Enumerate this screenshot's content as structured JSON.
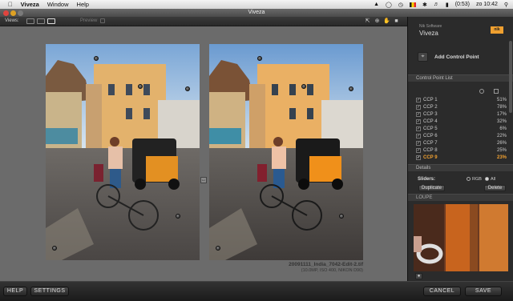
{
  "menubar": {
    "app": "Viveza",
    "items": [
      "Window",
      "Help"
    ],
    "battery": "(0:53)",
    "clock": "zo 10:42"
  },
  "window": {
    "title": "Viveza"
  },
  "toolbar": {
    "views_label": "Views:",
    "preview_label": "Preview"
  },
  "canvas": {
    "filename": "20091111_India_7042-Edit-2.tif",
    "meta": "(10.0MP, ISO 400, NIKON D90)"
  },
  "panel": {
    "brand_small": "Nik Software",
    "brand": "Viveza",
    "brand_badge": "nik",
    "add_control_point": "Add Control Point",
    "cp_list_header": "Control Point List",
    "control_points": [
      {
        "name": "CCP 1",
        "pct": "51%",
        "checked": true,
        "selected": false
      },
      {
        "name": "CCP 2",
        "pct": "78%",
        "checked": true,
        "selected": false
      },
      {
        "name": "CCP 3",
        "pct": "17%",
        "checked": true,
        "selected": false
      },
      {
        "name": "CCP 4",
        "pct": "32%",
        "checked": true,
        "selected": false
      },
      {
        "name": "CCP 5",
        "pct": "6%",
        "checked": true,
        "selected": false
      },
      {
        "name": "CCP 6",
        "pct": "22%",
        "checked": true,
        "selected": false
      },
      {
        "name": "CCP 7",
        "pct": "26%",
        "checked": true,
        "selected": false
      },
      {
        "name": "CCP 8",
        "pct": "25%",
        "checked": true,
        "selected": false
      },
      {
        "name": "CCP 9",
        "pct": "23%",
        "checked": true,
        "selected": true
      }
    ],
    "details_header": "Details",
    "sliders_label": "Sliders:",
    "rgb_label": "RGB",
    "all_label": "All",
    "duplicate": "Duplicate",
    "delete": "Delete",
    "loupe_header": "LOUPE"
  },
  "bottom": {
    "help": "HELP",
    "settings": "SETTINGS",
    "cancel": "CANCEL",
    "save": "SAVE"
  },
  "colors": {
    "accent": "#f0a030",
    "panel_bg": "#2b2b2b",
    "canvas_bg": "#6b6b6b"
  }
}
